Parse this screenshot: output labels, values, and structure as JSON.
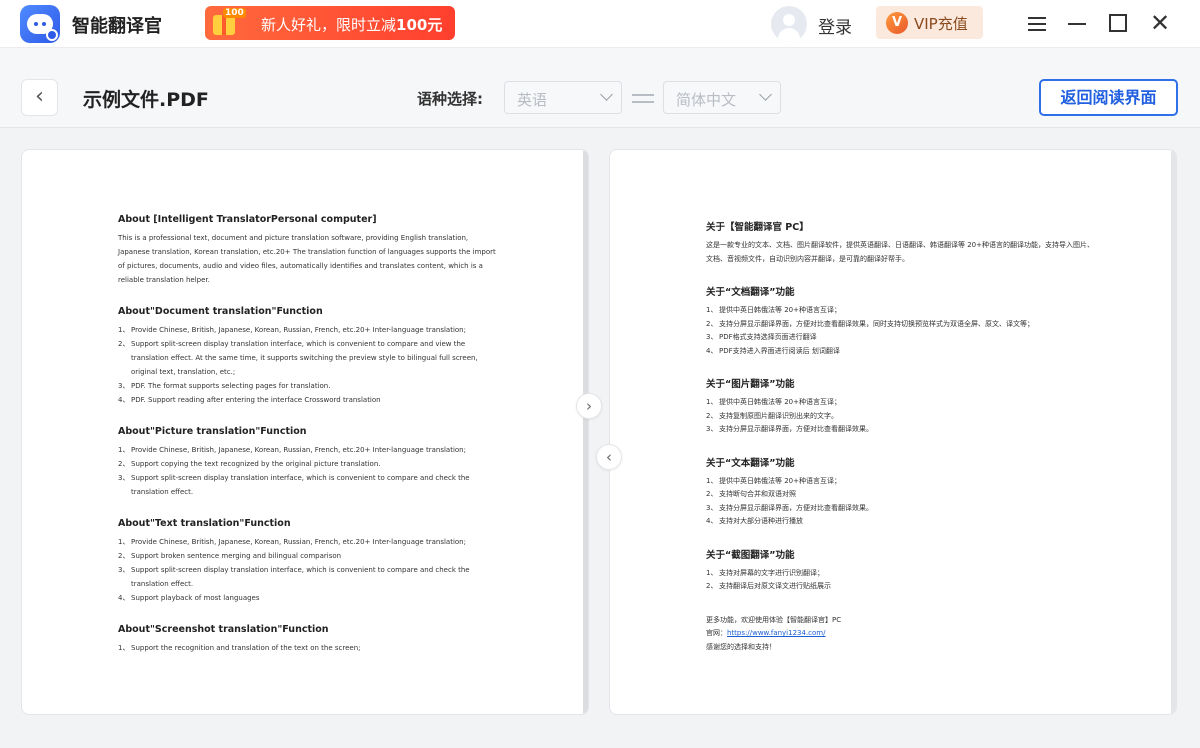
{
  "app": {
    "title": "智能翻译官",
    "promo_text": "新人好礼，限时立减",
    "promo_amount": "100元",
    "promo_tag": "100"
  },
  "header": {
    "login_label": "登录",
    "vip_icon": "V",
    "vip_label": "VIP充值"
  },
  "toolbar": {
    "back_icon": "chevron-left-icon",
    "file_name": "示例文件.PDF",
    "language_label": "语种选择:",
    "source_language": "英语",
    "target_language": "简体中文",
    "return_button": "返回阅读界面"
  },
  "original_doc": {
    "intro_title": "About [Intelligent TranslatorPersonal computer]",
    "intro_text": "This is a professional text, document and picture translation software, providing English translation, Japanese translation, Korean translation, etc.20+ The translation function of languages supports the import of pictures, documents, audio and video files, automatically identifies and translates content, which is a reliable translation helper.",
    "sections": [
      {
        "title": "About\"Document translation\"Function",
        "items": [
          {
            "num": "1、",
            "text": "Provide Chinese, British, Japanese, Korean, Russian, French, etc.20+ Inter-language translation;"
          },
          {
            "num": "2、",
            "text": "Support split-screen display translation interface, which is convenient to compare and view the translation effect. At the same time, it supports switching the preview style to bilingual full screen, original text, translation, etc.;"
          },
          {
            "num": "3、",
            "text": "PDF. The format supports selecting pages for translation."
          },
          {
            "num": "4、",
            "text": "PDF. Support reading after entering the interface Crossword translation"
          }
        ]
      },
      {
        "title": "About\"Picture translation\"Function",
        "items": [
          {
            "num": "1、",
            "text": "Provide Chinese, British, Japanese, Korean, Russian, French, etc.20+ Inter-language translation;"
          },
          {
            "num": "2、",
            "text": "Support copying the text recognized by the original picture translation."
          },
          {
            "num": "3、",
            "text": "Support split-screen display translation interface, which is convenient to compare and check the translation effect."
          }
        ]
      },
      {
        "title": "About\"Text translation\"Function",
        "items": [
          {
            "num": "1、",
            "text": "Provide Chinese, British, Japanese, Korean, Russian, French, etc.20+ Inter-language translation;"
          },
          {
            "num": "2、",
            "text": "Support broken sentence merging and bilingual comparison"
          },
          {
            "num": "3、",
            "text": "Support split-screen display translation interface, which is convenient to compare and check the translation effect."
          },
          {
            "num": "4、",
            "text": "Support playback of most languages"
          }
        ]
      },
      {
        "title": "About\"Screenshot translation\"Function",
        "items": [
          {
            "num": "1、",
            "text": "Support the recognition and translation of the text on the screen;"
          }
        ]
      }
    ]
  },
  "translated_doc": {
    "intro_title": "关于【智能翻译官 PC】",
    "intro_text": "这是一款专业的文本、文档、图片翻译软件，提供英语翻译、日语翻译、韩语翻译等 20+种语言的翻译功能，支持导入图片、文档、音视频文件，自动识别内容并翻译，是可靠的翻译好帮手。",
    "sections": [
      {
        "title": "关于“文档翻译”功能",
        "items": [
          {
            "num": "1、",
            "text": "提供中英日韩俄法等 20+种语言互译；"
          },
          {
            "num": "2、",
            "text": "支持分屏显示翻译界面，方便对比查看翻译效果，同时支持切换预览样式为双语全屏、原文、译文等；"
          },
          {
            "num": "3、",
            "text": "PDF格式支持选择页面进行翻译"
          },
          {
            "num": "4、",
            "text": "PDF支持进入界面进行阅读后 划词翻译"
          }
        ]
      },
      {
        "title": "关于“图片翻译”功能",
        "items": [
          {
            "num": "1、",
            "text": "提供中英日韩俄法等 20+种语言互译；"
          },
          {
            "num": "2、",
            "text": "支持复制原图片翻译识别出来的文字。"
          },
          {
            "num": "3、",
            "text": "支持分屏显示翻译界面，方便对比查看翻译效果。"
          }
        ]
      },
      {
        "title": "关于“文本翻译”功能",
        "items": [
          {
            "num": "1、",
            "text": "提供中英日韩俄法等 20+种语言互译；"
          },
          {
            "num": "2、",
            "text": "支持断句合并和双语对照"
          },
          {
            "num": "3、",
            "text": "支持分屏显示翻译界面，方便对比查看翻译效果。"
          },
          {
            "num": "4、",
            "text": "支持对大部分语种进行播放"
          }
        ]
      },
      {
        "title": "关于“截图翻译”功能",
        "items": [
          {
            "num": "1、",
            "text": "支持对屏幕的文字进行识别翻译；"
          },
          {
            "num": "2、",
            "text": "支持翻译后对原文译文进行贴纸展示"
          }
        ]
      }
    ],
    "footer_line1": "更多功能，欢迎使用体验【智能翻译官】PC",
    "footer_site_label": "官网：",
    "footer_site_url": "https://www.fanyi1234.com/",
    "footer_line3": "感谢您的选择和支持！"
  }
}
